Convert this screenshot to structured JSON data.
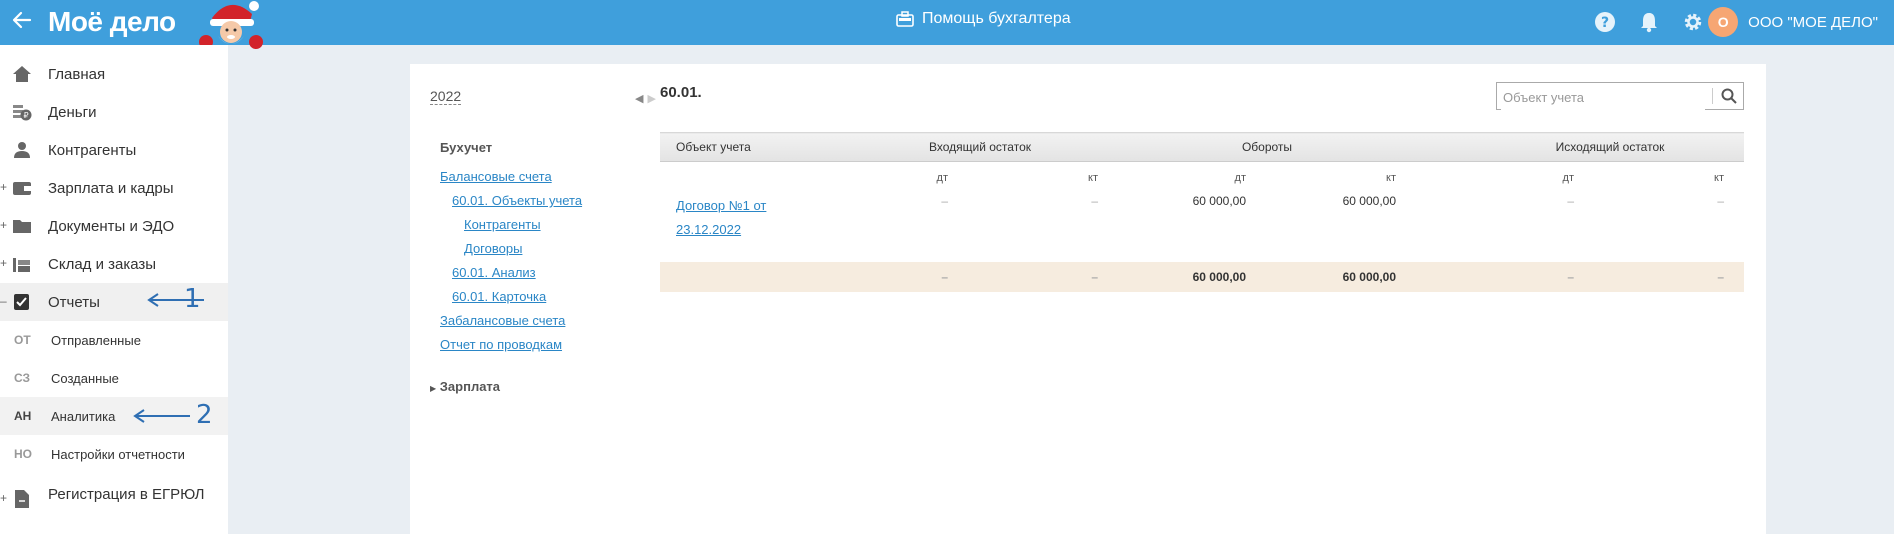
{
  "topbar": {
    "logo": "Моё дело",
    "center_title": "Помощь бухгалтера",
    "org_initial": "О",
    "org_name": "ООО \"МОЕ ДЕЛО\""
  },
  "sidebar": {
    "items": [
      {
        "label": "Главная",
        "icon": "home-icon"
      },
      {
        "label": "Деньги",
        "icon": "money-icon"
      },
      {
        "label": "Контрагенты",
        "icon": "contractors-icon"
      },
      {
        "label": "Зарплата и кадры",
        "icon": "wallet-icon"
      },
      {
        "label": "Документы и ЭДО",
        "icon": "folder-icon"
      },
      {
        "label": "Склад и заказы",
        "icon": "warehouse-icon"
      },
      {
        "label": "Отчеты",
        "icon": "report-icon"
      }
    ],
    "subitems": [
      {
        "abbr": "ОТ",
        "label": "Отправленные"
      },
      {
        "abbr": "СЗ",
        "label": "Созданные"
      },
      {
        "abbr": "АН",
        "label": "Аналитика"
      },
      {
        "abbr": "НО",
        "label": "Настройки отчетности"
      }
    ],
    "registration": "Регистрация в ЕГРЮЛ"
  },
  "annotations": {
    "one": "1",
    "two": "2"
  },
  "leftnav": {
    "year": "2022",
    "section": "Бухучет",
    "links": [
      {
        "label": "Балансовые счета",
        "level": 0
      },
      {
        "label": "60.01. Объекты учета",
        "level": 1
      },
      {
        "label": "Контрагенты",
        "level": 2
      },
      {
        "label": "Договоры",
        "level": 2
      },
      {
        "label": "60.01. Анализ",
        "level": 1
      },
      {
        "label": "60.01. Карточка",
        "level": 1
      },
      {
        "label": "Забалансовые счета",
        "level": 0
      },
      {
        "label": "Отчет по проводкам",
        "level": 0
      }
    ],
    "collapsed_section": "Зарплата"
  },
  "report": {
    "title": "60.01.",
    "search_placeholder": "Объект учета",
    "headers": {
      "object": "Объект учета",
      "opening": "Входящий остаток",
      "turnover": "Обороты",
      "closing": "Исходящий остаток"
    },
    "sub_headers": [
      "дт",
      "кт",
      "дт",
      "кт",
      "дт",
      "кт"
    ],
    "row": {
      "object_line1": "Договор №1 от",
      "object_line2": "23.12.2022",
      "values": [
        "–",
        "–",
        "60 000,00",
        "60 000,00",
        "–",
        "–"
      ]
    },
    "total": {
      "values": [
        "–",
        "–",
        "60 000,00",
        "60 000,00",
        "–",
        "–"
      ]
    }
  }
}
